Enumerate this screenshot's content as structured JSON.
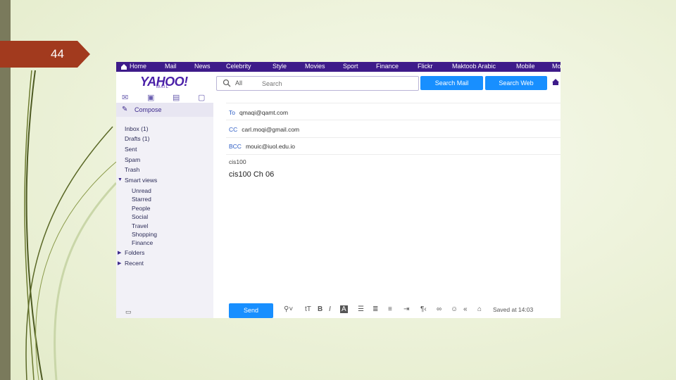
{
  "slide": {
    "number": "44"
  },
  "colors": {
    "nav_bg": "#3e1b8a",
    "accent": "#188fff",
    "sidebar_bg": "#f2f1f7",
    "slide_tab": "#a23a1e"
  },
  "topnav": {
    "items": [
      "Home",
      "Mail",
      "News",
      "Celebrity",
      "Style",
      "Movies",
      "Sport",
      "Finance",
      "Flickr",
      "Maktoob Arabic",
      "Mobile",
      "Mo"
    ]
  },
  "header": {
    "logo": "YAHOO!",
    "logo_sub": "MAIL",
    "search_scope": "All",
    "search_placeholder": "Search",
    "search_mail_label": "Search Mail",
    "search_web_label": "Search Web"
  },
  "sidebar": {
    "compose_label": "Compose",
    "folders": [
      {
        "label": "Inbox (1)"
      },
      {
        "label": "Drafts (1)"
      },
      {
        "label": "Sent"
      },
      {
        "label": "Spam"
      },
      {
        "label": "Trash"
      }
    ],
    "smart_views_label": "Smart views",
    "smart_views": [
      "Unread",
      "Starred",
      "People",
      "Social",
      "Travel",
      "Shopping",
      "Finance"
    ],
    "folders_label": "Folders",
    "recent_label": "Recent"
  },
  "compose": {
    "to_label": "To",
    "to_value": "qmaqi@qamt.com",
    "cc_label": "CC",
    "cc_value": "carl.moqi@gmail.com",
    "bcc_label": "BCC",
    "bcc_value": "mouic@iuol.edu.io",
    "subject": "cis100",
    "body": "cis100 Ch 06",
    "send_label": "Send",
    "saved_text": "Saved at 14:03"
  }
}
